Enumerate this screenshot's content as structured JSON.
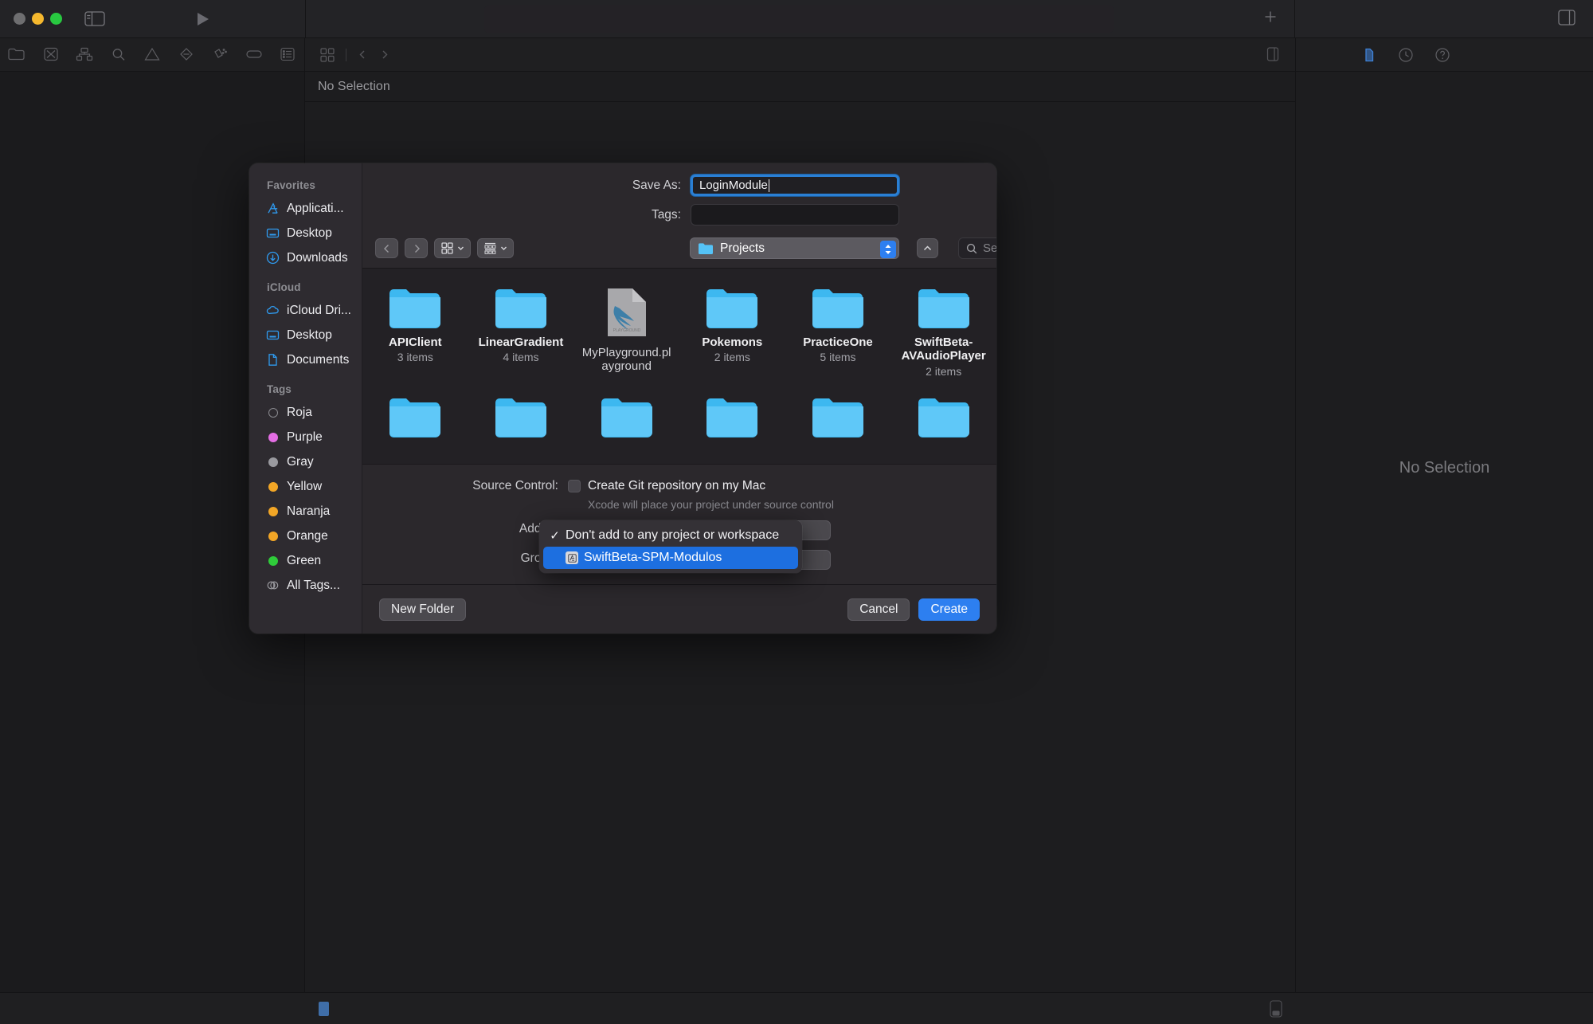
{
  "window": {
    "traffic_lights": [
      "close",
      "minimize",
      "maximize"
    ],
    "jumpbar_text": "No Selection",
    "inspector_empty_text": "No Selection"
  },
  "navigator_toolbar": {
    "icons": [
      "folder-icon",
      "source-control-icon",
      "hierarchy-icon",
      "search-icon",
      "warning-icon",
      "breakpoint-icon",
      "test-icon",
      "tag-icon",
      "report-icon"
    ]
  },
  "dialog": {
    "sidebar": {
      "groups": [
        {
          "title": "Favorites",
          "items": [
            {
              "label": "Applicati...",
              "icon": "applications-icon"
            },
            {
              "label": "Desktop",
              "icon": "desktop-icon"
            },
            {
              "label": "Downloads",
              "icon": "downloads-icon"
            }
          ]
        },
        {
          "title": "iCloud",
          "items": [
            {
              "label": "iCloud Dri...",
              "icon": "icloud-icon"
            },
            {
              "label": "Desktop",
              "icon": "desktop-icon"
            },
            {
              "label": "Documents",
              "icon": "document-icon"
            }
          ]
        },
        {
          "title": "Tags",
          "items": [
            {
              "label": "Roja",
              "icon": "tag-dot",
              "color": "hollow"
            },
            {
              "label": "Purple",
              "icon": "tag-dot",
              "color": "#e46ee4"
            },
            {
              "label": "Gray",
              "icon": "tag-dot",
              "color": "#9a9a9f"
            },
            {
              "label": "Yellow",
              "icon": "tag-dot",
              "color": "#f2a626"
            },
            {
              "label": "Naranja",
              "icon": "tag-dot",
              "color": "#f2a626"
            },
            {
              "label": "Orange",
              "icon": "tag-dot",
              "color": "#f2a626"
            },
            {
              "label": "Green",
              "icon": "tag-dot",
              "color": "#2fcc3a"
            },
            {
              "label": "All Tags...",
              "icon": "all-tags-icon",
              "color": "hollow"
            }
          ]
        }
      ]
    },
    "fields": {
      "save_as_label": "Save As:",
      "save_as_value": "LoginModule",
      "tags_label": "Tags:",
      "tags_value": ""
    },
    "navbar": {
      "back_label": "‹",
      "forward_label": "›",
      "path_label": "Projects",
      "search_placeholder": "Search"
    },
    "files": [
      {
        "name": "APIClient",
        "sub": "3 items",
        "kind": "folder"
      },
      {
        "name": "LinearGradient",
        "sub": "4 items",
        "kind": "folder"
      },
      {
        "name": "MyPlayground.playground",
        "sub": "",
        "kind": "playground"
      },
      {
        "name": "Pokemons",
        "sub": "2 items",
        "kind": "folder"
      },
      {
        "name": "PracticeOne",
        "sub": "5 items",
        "kind": "folder"
      },
      {
        "name": "SwiftBeta-AVAudioPlayer",
        "sub": "2 items",
        "kind": "folder"
      }
    ],
    "files_row2_count": 6,
    "options": {
      "source_control_label": "Source Control:",
      "git_checkbox_label": "Create Git repository on my Mac",
      "git_checkbox_checked": false,
      "git_hint": "Xcode will place your project under source control",
      "add_to_label": "Add to:",
      "group_label": "Group:"
    },
    "menu": {
      "items": [
        {
          "label": "Don't add to any project or workspace",
          "checked": true,
          "selected": false,
          "icon": ""
        },
        {
          "label": "SwiftBeta-SPM-Modulos",
          "checked": false,
          "selected": true,
          "icon": "xcode-project-icon"
        }
      ],
      "check_glyph": "✓"
    },
    "footer": {
      "new_folder_label": "New Folder",
      "cancel_label": "Cancel",
      "create_label": "Create"
    }
  },
  "colors": {
    "accent_blue": "#2d7ff0",
    "folder_blue": "#55c3f7",
    "menu_highlight": "#1d6fe0",
    "focus_ring": "#2a7fd4"
  }
}
